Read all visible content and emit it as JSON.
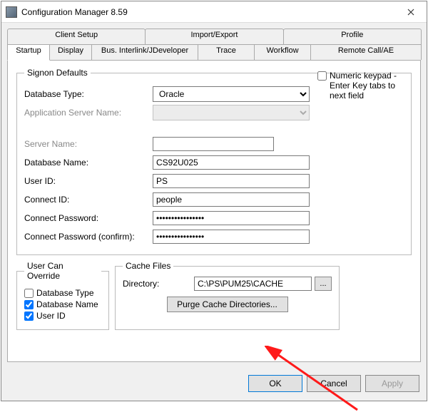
{
  "window": {
    "title": "Configuration Manager 8.59"
  },
  "tabs": {
    "top": [
      "Client Setup",
      "Import/Export",
      "Profile"
    ],
    "bottom": [
      "Startup",
      "Display",
      "Bus. Interlink/JDeveloper",
      "Trace",
      "Workflow",
      "Remote Call/AE"
    ],
    "active": "Startup"
  },
  "numericKeypad": {
    "label": "Numeric keypad - Enter Key tabs to next field"
  },
  "signon": {
    "legend": "Signon Defaults",
    "dbtype_label": "Database Type:",
    "dbtype_value": "Oracle",
    "appserver_label": "Application Server Name:",
    "servername_label": "Server Name:",
    "servername_value": "",
    "dbname_label": "Database Name:",
    "dbname_value": "CS92U025",
    "userid_label": "User ID:",
    "userid_value": "PS",
    "connectid_label": "Connect ID:",
    "connectid_value": "people",
    "cpw_label": "Connect Password:",
    "cpw_value": "••••••••••••••••",
    "cpw2_label": "Connect Password (confirm):",
    "cpw2_value": "••••••••••••••••"
  },
  "override": {
    "legend": "User Can Override",
    "dbtype": "Database Type",
    "dbname": "Database Name",
    "userid": "User ID"
  },
  "cache": {
    "legend": "Cache Files",
    "dir_label": "Directory:",
    "dir_value": "C:\\PS\\PUM25\\CACHE",
    "browse": "...",
    "purge": "Purge Cache Directories..."
  },
  "buttons": {
    "ok": "OK",
    "cancel": "Cancel",
    "apply": "Apply"
  }
}
